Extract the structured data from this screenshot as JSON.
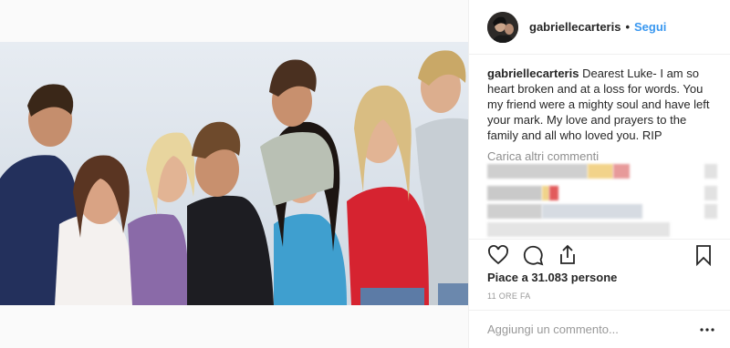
{
  "post": {
    "username": "gabriellecarteris",
    "follow_label": "Segui",
    "separator": "•",
    "caption_username": "gabriellecarteris",
    "caption_text": "Dearest Luke- I am so heart broken and at a loss for words. You my friend were a mighty soul and have left your mark. My love and prayers to the family and all who loved you. RIP",
    "load_more_label": "Carica altri commenti",
    "likes_label": "Piace a 31.083 persone",
    "timestamp": "11 ORE FA",
    "comment_placeholder": "Aggiungi un commento...",
    "more_glyph": "•••"
  },
  "colors": {
    "link_blue": "#3897f0",
    "text": "#262626",
    "muted": "#8e8e8e",
    "border": "#efefef"
  },
  "icons": [
    "heart-icon",
    "comment-icon",
    "share-icon",
    "bookmark-icon",
    "more-options-icon"
  ]
}
